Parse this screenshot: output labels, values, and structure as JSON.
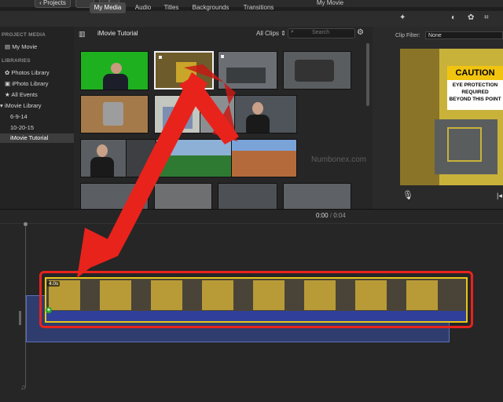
{
  "window": {
    "title": "My Movie",
    "back_button": "Projects"
  },
  "tabs": [
    "My Media",
    "Audio",
    "Titles",
    "Backgrounds",
    "Transitions"
  ],
  "sidebar": {
    "project_header": "PROJECT MEDIA",
    "project_item": "My Movie",
    "libraries_header": "LIBRARIES",
    "items": [
      "Photos Library",
      "iPhoto Library",
      "All Events",
      "iMovie Library",
      "6-9-14",
      "10-20-15",
      "iMovie Tutorial"
    ]
  },
  "browser": {
    "event_title": "iMovie Tutorial",
    "filter": "All Clips",
    "search_placeholder": "Search"
  },
  "viewer": {
    "clip_filter_label": "Clip Filter:",
    "clip_filter_value": "None",
    "sign": {
      "title": "CAUTION",
      "lines": [
        "EYE PROTECTION",
        "REQUIRED",
        "BEYOND THIS POINT"
      ]
    }
  },
  "timeline": {
    "current_time": "0:00",
    "separator": "/",
    "total_time": "0:04",
    "clip_duration": "4.0s"
  },
  "watermark": "Numbonex.com",
  "icons": [
    "sidebar-toggle-icon",
    "settings-gear-icon",
    "magic-wand-icon",
    "color-balance-icon",
    "color-palette-icon",
    "crop-icon",
    "microphone-icon",
    "camera-icon",
    "music-note-icon",
    "search-icon"
  ],
  "colors": {
    "annotation_red": "#e8231c",
    "clip_border": "#e9c61a",
    "audio_blue": "#2f3f9a",
    "accent": "#4a4a4a"
  }
}
